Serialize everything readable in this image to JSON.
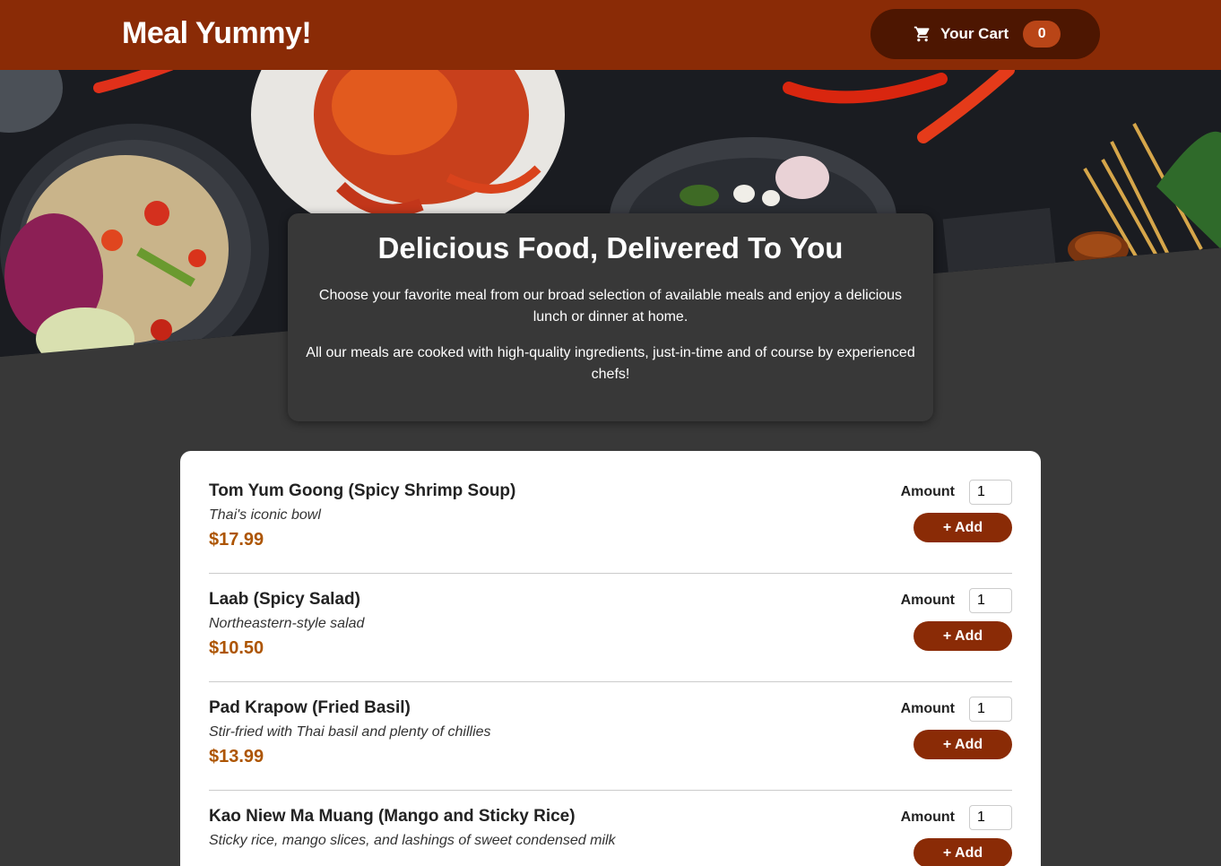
{
  "header": {
    "brand": "Meal Yummy!",
    "cart_label": "Your Cart",
    "cart_count": "0"
  },
  "summary": {
    "title": "Delicious Food, Delivered To You",
    "paragraph_1": "Choose your favorite meal from our broad selection of available meals and enjoy a delicious lunch or dinner at home.",
    "paragraph_2": "All our meals are cooked with high-quality ingredients, just-in-time and of course by experienced chefs!"
  },
  "meals": [
    {
      "name": "Tom Yum Goong (Spicy Shrimp Soup)",
      "description": "Thai's iconic bowl",
      "price": "$17.99",
      "amount_label": "Amount",
      "amount_value": "1",
      "add_label": "+ Add"
    },
    {
      "name": "Laab (Spicy Salad)",
      "description": "Northeastern-style salad",
      "price": "$10.50",
      "amount_label": "Amount",
      "amount_value": "1",
      "add_label": "+ Add"
    },
    {
      "name": "Pad Krapow (Fried Basil)",
      "description": "Stir-fried with Thai basil and plenty of chillies",
      "price": "$13.99",
      "amount_label": "Amount",
      "amount_value": "1",
      "add_label": "+ Add"
    },
    {
      "name": "Kao Niew Ma Muang (Mango and Sticky Rice)",
      "description": "Sticky rice, mango slices, and lashings of sweet condensed milk",
      "price": "",
      "amount_label": "Amount",
      "amount_value": "1",
      "add_label": "+ Add"
    }
  ],
  "colors": {
    "header_bg": "#8a2b06",
    "cart_bg": "#4d1601",
    "badge_bg": "#b94517",
    "price": "#ad5502",
    "page_bg": "#383838"
  },
  "icons": {
    "cart": "cart-icon"
  }
}
